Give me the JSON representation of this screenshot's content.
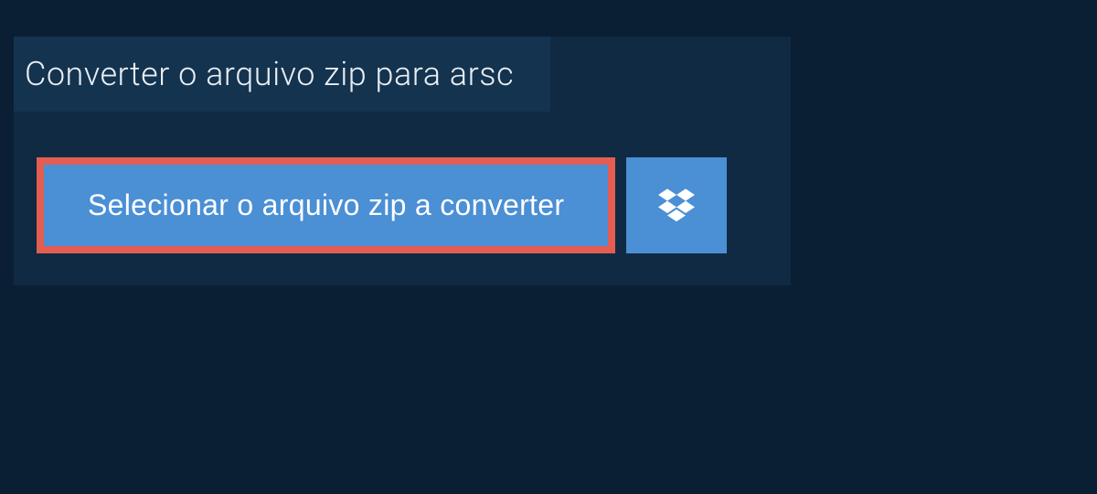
{
  "header": {
    "title": "Converter o arquivo zip para arsc"
  },
  "actions": {
    "select_file_label": "Selecionar o arquivo zip a converter"
  },
  "colors": {
    "background": "#0a1f33",
    "panel": "#0f2a42",
    "header_tab": "#14334f",
    "button": "#4b8fd5",
    "highlight_border": "#e35d52",
    "text_light": "#e8eef4",
    "text_white": "#ffffff"
  },
  "icons": {
    "dropbox": "dropbox-icon"
  }
}
